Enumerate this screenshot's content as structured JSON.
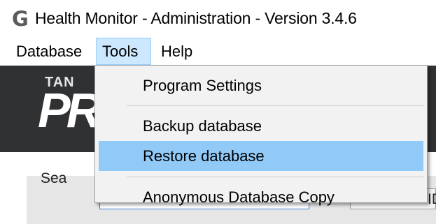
{
  "window": {
    "icon_letter": "G",
    "title": "Health Monitor - Administration - Version 3.4.6"
  },
  "menubar": {
    "items": [
      {
        "label": "Database"
      },
      {
        "label": "Tools"
      },
      {
        "label": "Help"
      }
    ]
  },
  "banner": {
    "logo_small": "TAN",
    "logo_big": "PR"
  },
  "search": {
    "label": "Sea",
    "right_field_text": "ID"
  },
  "tools_menu": {
    "items": [
      {
        "label": "Program Settings"
      },
      {
        "label": "Backup database"
      },
      {
        "label": "Restore database",
        "highlighted": true
      },
      {
        "label": "Anonymous Database Copy"
      }
    ]
  },
  "colors": {
    "banner_bg": "#2f3133",
    "menu_highlight": "#91c9f7",
    "menubar_active": "#cce8ff",
    "dropdown_bg": "#f2f2f2"
  }
}
